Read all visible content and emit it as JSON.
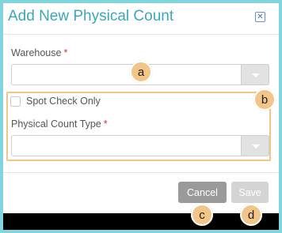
{
  "dialog": {
    "title": "Add New Physical Count",
    "close_symbol": "✕"
  },
  "fields": {
    "warehouse": {
      "label": "Warehouse",
      "required_marker": "*",
      "value": ""
    },
    "spot_check": {
      "label": "Spot Check Only",
      "checked": false
    },
    "physical_count_type": {
      "label": "Physical Count Type",
      "required_marker": "*",
      "value": ""
    }
  },
  "buttons": {
    "cancel": "Cancel",
    "save": "Save"
  },
  "callouts": [
    "a",
    "b",
    "c",
    "d"
  ],
  "colors": {
    "accent": "#3aa8b8",
    "callout": "#f2c589",
    "required": "#d9302c",
    "background": "#7fd6dc"
  },
  "icons": {
    "close": "close-icon",
    "dropdown": "chevron-down-icon"
  }
}
